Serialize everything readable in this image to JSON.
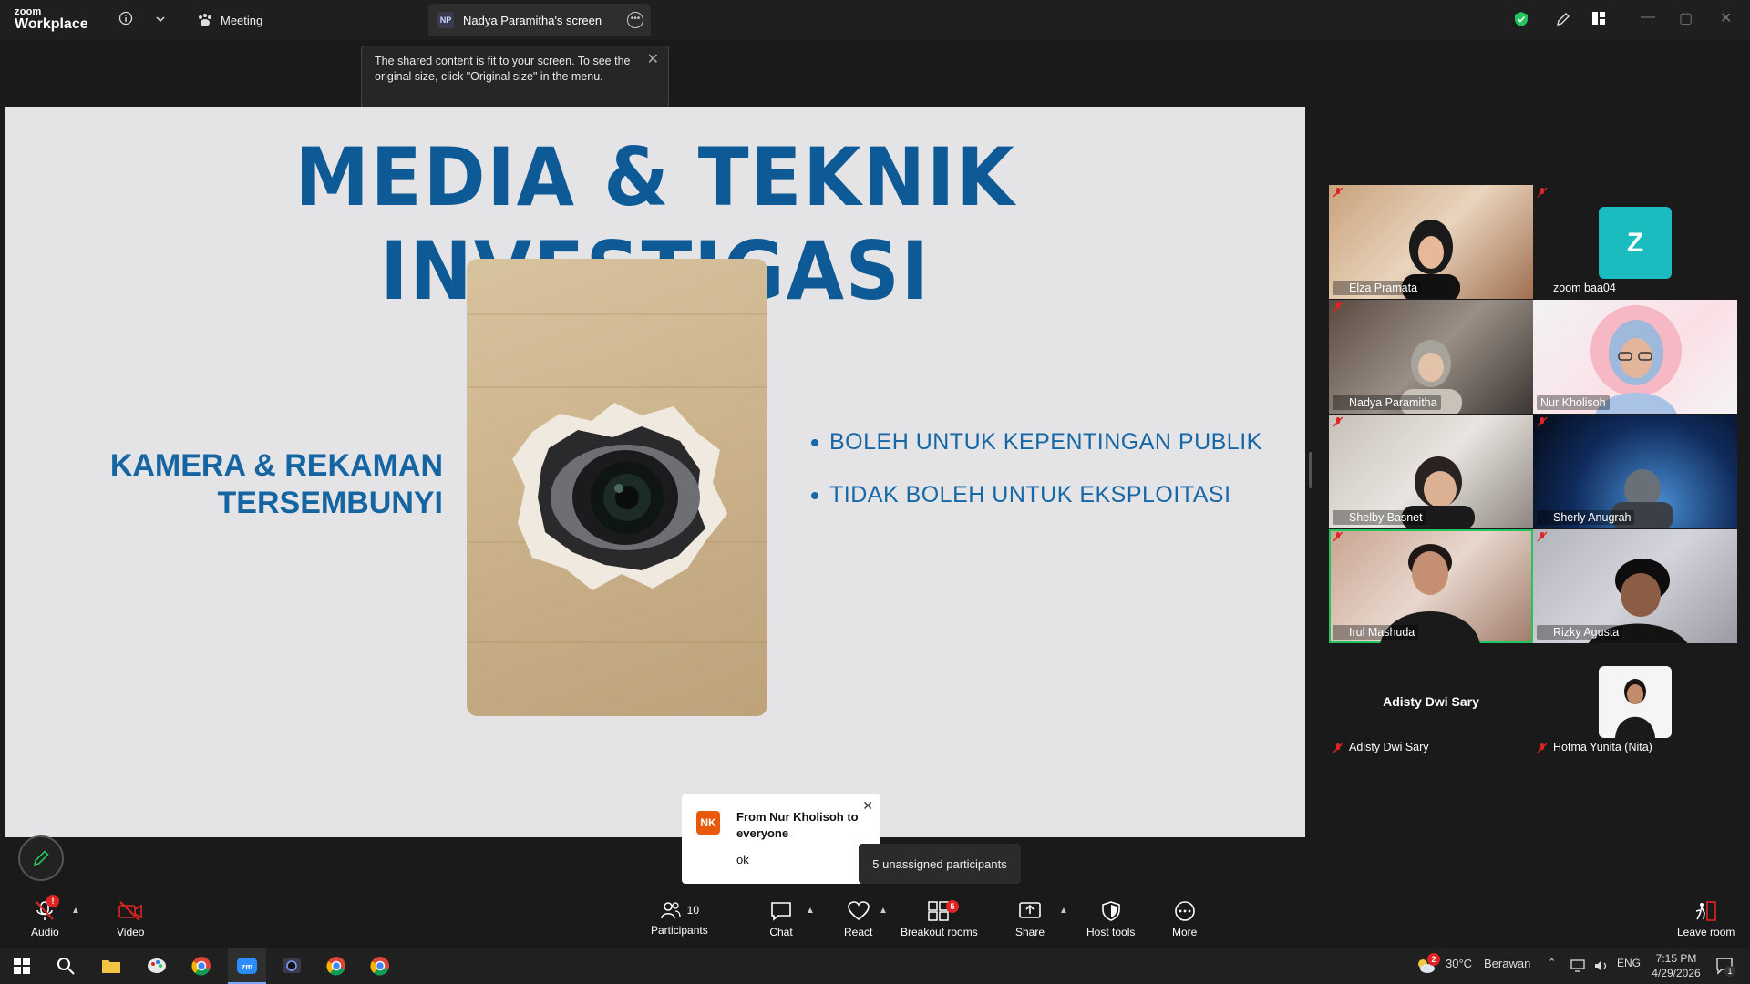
{
  "titlebar": {
    "logo_top": "zoom",
    "logo_bottom": "Workplace",
    "meeting_label": "Meeting",
    "screen_tab_initials": "NP",
    "screen_tab_label": "Nadya Paramitha's screen"
  },
  "tooltip": {
    "text": "The shared content is fit to your screen. To see the original size, click \"Original size\" in the menu."
  },
  "slide": {
    "title": "MEDIA & TEKNIK INVESTIGASI",
    "left_line1": "KAMERA & REKAMAN",
    "left_line2": "TERSEMBUNYI",
    "bullets": [
      "BOLEH UNTUK KEPENTINGAN PUBLIK",
      "TIDAK BOLEH UNTUK EKSPLOITASI"
    ]
  },
  "gallery": {
    "participants": [
      {
        "name": "Elza Pramata",
        "muted": true
      },
      {
        "name": "zoom baa04",
        "muted": true,
        "avatar_letter": "Z"
      },
      {
        "name": "Nadya Paramitha",
        "muted": true
      },
      {
        "name": "Nur Kholisoh",
        "muted": false
      },
      {
        "name": "Shelby Basnet",
        "muted": true
      },
      {
        "name": "Sherly Anugrah",
        "muted": true
      },
      {
        "name": "Irul Mashuda",
        "muted": true,
        "active_speaker": true
      },
      {
        "name": "Rizky Agusta",
        "muted": true
      },
      {
        "name": "Adisty Dwi Sary",
        "muted": true,
        "video_off": true
      },
      {
        "name": "Hotma Yunita (Nita)",
        "muted": true
      }
    ],
    "adisty_display": "Adisty Dwi Sary"
  },
  "chat_popup": {
    "initials": "NK",
    "from": "From Nur Kholisoh to everyone",
    "message": "ok"
  },
  "unassigned": "5 unassigned participants",
  "toolbar": {
    "audio": "Audio",
    "video": "Video",
    "participants": "Participants",
    "participants_count": "10",
    "chat": "Chat",
    "react": "React",
    "breakout": "Breakout rooms",
    "breakout_badge": "5",
    "share": "Share",
    "host_tools": "Host tools",
    "more": "More",
    "leave": "Leave room"
  },
  "taskbar": {
    "weather_temp": "30°C",
    "weather_text": "Berawan",
    "weather_badge": "2",
    "lang": "ENG",
    "time": "7:15 PM",
    "date": "4/29/2026",
    "notif_count": "1"
  },
  "colors": {
    "accent_blue": "#0e5a96",
    "active_speaker": "#22c55e",
    "muted_red": "#e02424",
    "security_green": "#22c55e"
  }
}
